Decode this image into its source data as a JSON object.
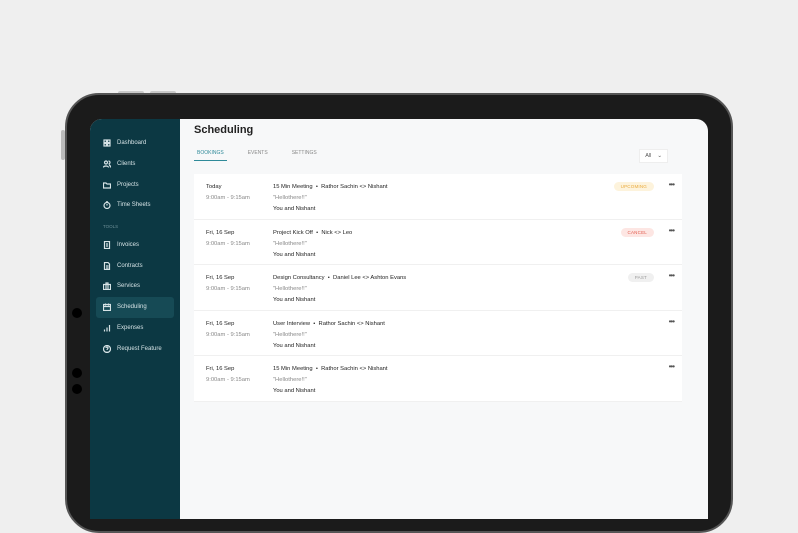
{
  "sidebar": {
    "items": [
      {
        "label": "Dashboard",
        "icon": "grid-icon"
      },
      {
        "label": "Clients",
        "icon": "users-icon"
      },
      {
        "label": "Projects",
        "icon": "folder-icon"
      },
      {
        "label": "Time Sheets",
        "icon": "stopwatch-icon"
      }
    ],
    "section": "TOOLS",
    "tools": [
      {
        "label": "Invoices",
        "icon": "invoice-icon"
      },
      {
        "label": "Contracts",
        "icon": "contract-icon"
      },
      {
        "label": "Services",
        "icon": "briefcase-icon"
      },
      {
        "label": "Scheduling",
        "icon": "calendar-icon"
      },
      {
        "label": "Expenses",
        "icon": "bar-chart-icon"
      },
      {
        "label": "Request Feature",
        "icon": "help-icon"
      }
    ]
  },
  "page": {
    "title": "Scheduling",
    "tabs": [
      "BOOKINGS",
      "EVENTS",
      "SETTINGS"
    ],
    "filter": "All"
  },
  "bookings": [
    {
      "date": "Today",
      "time": "9:00am - 9:15am",
      "title": "15 Min Meeting",
      "people": "Rathor Sachin <> Nishant",
      "note": "\"Hellothere!!\"",
      "attendees": "You and Nishant",
      "status": "UPCOMING"
    },
    {
      "date": "Fri, 16 Sep",
      "time": "9:00am - 9:15am",
      "title": "Project Kick Off",
      "people": "Nick <> Leo",
      "note": "\"Hellothere!!\"",
      "attendees": "You and Nishant",
      "status": "CANCEL"
    },
    {
      "date": "Fri, 16 Sep",
      "time": "9:00am - 9:15am",
      "title": "Design Consultancy",
      "people": "Daniel Lee <> Ashton Evans",
      "note": "\"Hellothere!!\"",
      "attendees": "You and Nishant",
      "status": "PAST"
    },
    {
      "date": "Fri, 16 Sep",
      "time": "9:00am - 9:15am",
      "title": "User Interview",
      "people": "Rathor Sachin <> Nishant",
      "note": "\"Hellothere!!\"",
      "attendees": "You and Nishant",
      "status": null
    },
    {
      "date": "Fri, 16 Sep",
      "time": "9:00am - 9:15am",
      "title": "15 Min Meeting",
      "people": "Rathor Sachin <> Nishant",
      "note": "\"Hellothere!!\"",
      "attendees": "You and Nishant",
      "status": null
    }
  ],
  "colors": {
    "sidebar": "#0c3843",
    "accent": "#2f8a99",
    "upcoming": "#e9a93a",
    "cancel": "#e25c4f",
    "past": "#999999"
  }
}
